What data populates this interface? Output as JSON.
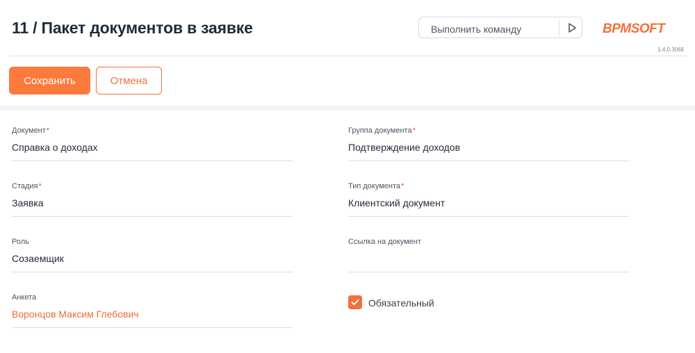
{
  "header": {
    "title": "11 / Пакет документов в заявке",
    "command": {
      "placeholder": "Выполнить команду",
      "run_icon": "play-triangle-icon"
    },
    "logo": {
      "text": "BPMSOFT",
      "color": "#f2703a"
    },
    "version": "1.4.0.3068"
  },
  "actions": {
    "save_label": "Сохранить",
    "cancel_label": "Отмена"
  },
  "form": {
    "left": [
      {
        "label": "Документ",
        "required": "*",
        "value": "Справка о доходах"
      },
      {
        "label": "Стадия",
        "required": "*",
        "value": "Заявка"
      },
      {
        "label": "Роль",
        "required": "",
        "value": "Созаемщик"
      },
      {
        "label": "Анкета",
        "required": "",
        "value": "Воронцов Максим Глебович"
      }
    ],
    "right": [
      {
        "label": "Группа документа",
        "required": "*",
        "value": "Подтверждение доходов"
      },
      {
        "label": "Тип документа",
        "required": "*",
        "value": "Клиентский документ"
      },
      {
        "label": "Ссылка на документ",
        "required": "",
        "value": ""
      }
    ],
    "mandatory": {
      "label": "Обязательный",
      "checked": true
    }
  },
  "colors": {
    "accent": "#fb7a3c",
    "link": "#ef6b34",
    "required": "#ef4444"
  }
}
